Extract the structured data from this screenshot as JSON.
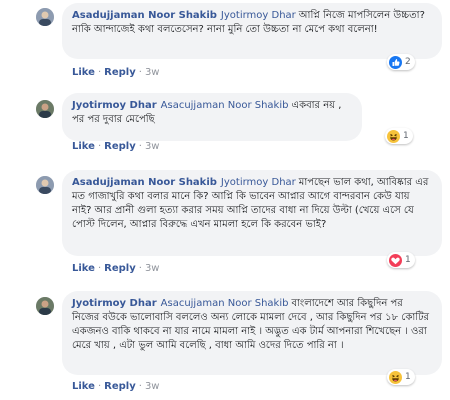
{
  "comments": [
    {
      "author": "Asadujjaman Noor Shakib",
      "mention": "Jyotirmoy Dhar",
      "text": "আপ্নি নিজে মাপসিলেন উচ্চতা? নাকি আন্দাজেই কথা বলতেসেন? নানা মুনি তো উচ্চতা না মেপে কথা বলেনা!",
      "like": "Like",
      "reply": "Reply",
      "time": "3w",
      "reaction": {
        "type": "like-icon",
        "count": "2"
      }
    },
    {
      "author": "Jyotirmoy Dhar",
      "mention": "Asacujjaman Noor Shakib",
      "text": "একবার নয় , পর পর দুবার মেপেছি",
      "like": "Like",
      "reply": "Reply",
      "time": "3w",
      "reaction": {
        "type": "haha-icon",
        "count": "1"
      }
    },
    {
      "author": "Asadujjaman Noor Shakib",
      "mention": "Jyotirmoy Dhar",
      "text": "মাপছেন ভাল কথা, আবিষ্কার এর মত গাজাখুরি কথা বলার মানে কি? আপ্নি কি ভাবেন আপ্নার আগে বান্দরবান কেউ যায় নাই? আর প্রানী গুলা হত্যা করার সময় আপ্নি তাদের বাধা না দিয়ে উল্টা (খেয়ে এসে যে পোস্ট দিলেন, আপ্নার বিরুদ্ধে এখন মামলা হলে কি করবেন ভাই?",
      "like": "Like",
      "reply": "Reply",
      "time": "3w",
      "reaction": {
        "type": "love-icon",
        "count": "1"
      }
    },
    {
      "author": "Jyotirmoy Dhar",
      "mention": "Asacujjaman Noor Shakib",
      "text": "বাংলাদেশে আর কিছুদিন পর নিজের বউকে ভালোবাসি বললেও অন্য লোকে মামলা দেবে , আর কিছুদিন পর ১৮ কোটির একজনও বাকি থাকবে না যার নামে মামলা নাই । অদ্ভুত এক টার্ম আপনারা শিখেছেন । ওরা মেরে খায় , এটা ভুল আমি বলেছি , বাধা আমি ওদের দিতে পারি না ।",
      "like": "Like",
      "reply": "Reply",
      "time": "3w",
      "reaction": {
        "type": "haha-icon",
        "count": "1"
      }
    }
  ],
  "colors": {
    "link": "#385898",
    "bubble": "#f2f3f5",
    "meta": "#90949c"
  }
}
